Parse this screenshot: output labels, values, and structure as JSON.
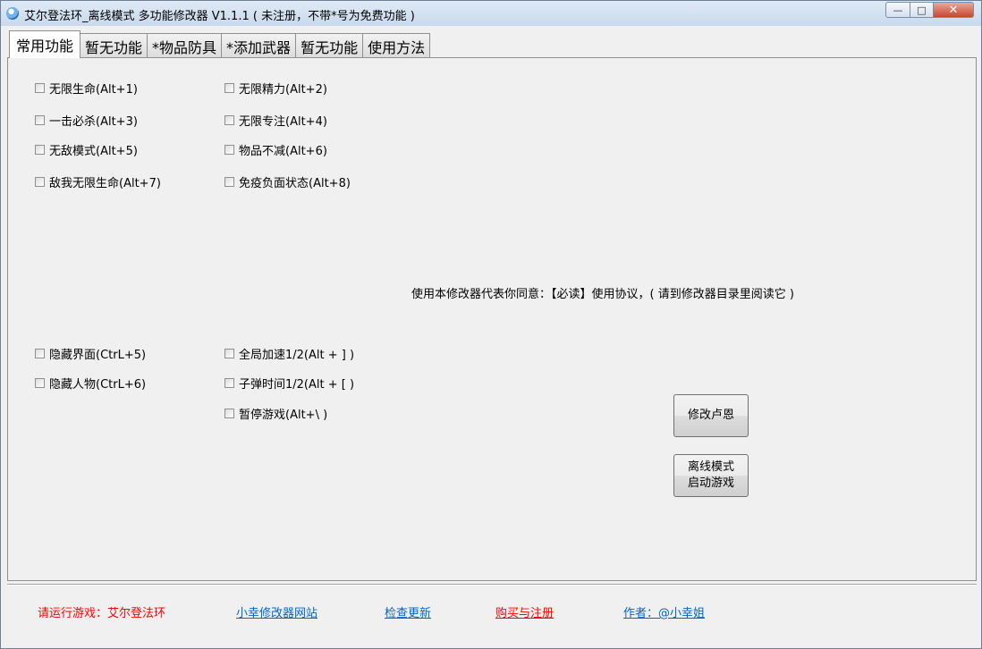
{
  "window": {
    "title": "艾尔登法环_离线模式 多功能修改器  V1.1.1 ( 未注册，不带*号为免费功能 )",
    "controls": {
      "minimize": "—",
      "maximize": "□",
      "close": "✕"
    }
  },
  "tabs": [
    {
      "label": "常用功能",
      "active": true
    },
    {
      "label": "暂无功能"
    },
    {
      "label": "*物品防具"
    },
    {
      "label": "*添加武器"
    },
    {
      "label": "暂无功能"
    },
    {
      "label": "使用方法"
    }
  ],
  "checkboxes": {
    "c1": "无限生命(Alt+1)",
    "c2": "无限精力(Alt+2)",
    "c3": "一击必杀(Alt+3)",
    "c4": "无限专注(Alt+4)",
    "c5": "无敌模式(Alt+5)",
    "c6": "物品不减(Alt+6)",
    "c7": "敌我无限生命(Alt+7)",
    "c8": "免疫负面状态(Alt+8)",
    "c9": "隐藏界面(CtrL+5)",
    "c10": "全局加速1/2(Alt + ] )",
    "c11": "隐藏人物(CtrL+6)",
    "c12": "子弹时间1/2(Alt + [ )",
    "c13": "暂停游戏(Alt+\\ )"
  },
  "notice": "使用本修改器代表你同意：【必读】使用协议，( 请到修改器目录里阅读它 )",
  "buttons": {
    "modify_runes": "修改卢恩",
    "offline_line1": "离线模式",
    "offline_line2": "启动游戏"
  },
  "footer": {
    "status": "请运行游戏：艾尔登法环",
    "site_link": "小幸修改器网站",
    "update_link": "检查更新",
    "buy_link": "购买与注册",
    "author_link": "作者：@小幸姐"
  },
  "colors": {
    "status_red": "#ff0000",
    "link_blue": "#0066cc",
    "link_red": "#ff0000"
  }
}
